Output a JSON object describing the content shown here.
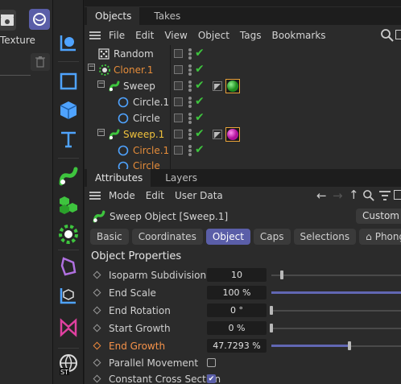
{
  "left": {
    "texture_label": "Texture"
  },
  "object_manager": {
    "tabs": [
      "Objects",
      "Takes"
    ],
    "menu": [
      "File",
      "Edit",
      "View",
      "Object",
      "Tags",
      "Bookmarks"
    ],
    "rows": [
      {
        "name": "Random",
        "color": "#d6d6d6"
      },
      {
        "name": "Cloner.1",
        "color": "#e58c3a"
      },
      {
        "name": "Sweep",
        "color": "#d6d6d6"
      },
      {
        "name": "Circle.1",
        "color": "#d6d6d6"
      },
      {
        "name": "Circle",
        "color": "#d6d6d6"
      },
      {
        "name": "Sweep.1",
        "color": "#f0c23c"
      },
      {
        "name": "Circle.1",
        "color": "#e58c3a"
      },
      {
        "name": "Circle",
        "color": "#e58c3a"
      }
    ]
  },
  "attribute_manager": {
    "tabs": [
      "Attributes",
      "Layers"
    ],
    "menu": [
      "Mode",
      "Edit",
      "User Data"
    ],
    "object_title": "Sweep Object [Sweep.1]",
    "mode_dropdown": "Custom",
    "subtabs": [
      "Basic",
      "Coordinates",
      "Object",
      "Caps",
      "Selections",
      "Phong"
    ],
    "active_subtab": "Object",
    "section_title": "Object Properties",
    "properties": [
      {
        "label": "Isoparm Subdivision",
        "value": "10"
      },
      {
        "label": "End Scale",
        "value": "100 %"
      },
      {
        "label": "End Rotation",
        "value": "0 °"
      },
      {
        "label": "Start Growth",
        "value": "0 %"
      },
      {
        "label": "End Growth",
        "value": "47.7293 %"
      },
      {
        "label": "Parallel Movement",
        "checked": false
      },
      {
        "label": "Constant Cross Section",
        "checked": true
      }
    ]
  },
  "colors": {
    "accent": "#5a5ea8",
    "check_green": "#3ec43e",
    "orange": "#e58c3a",
    "yellow": "#f0c23c"
  }
}
